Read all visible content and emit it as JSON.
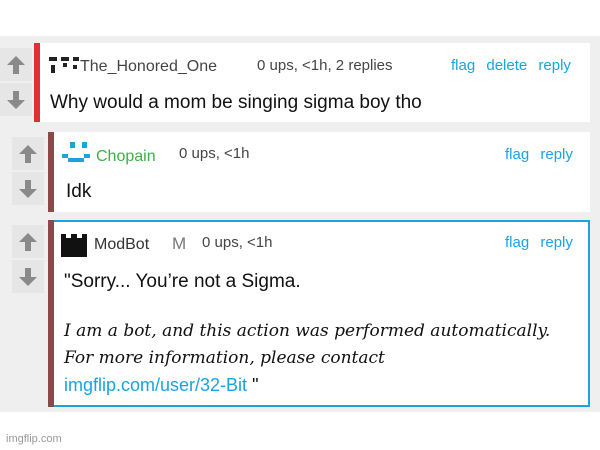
{
  "comments": [
    {
      "username": "The_Honored_One",
      "mod_badge": "",
      "meta": "0 ups, <1h, 2 replies",
      "actions": [
        "flag",
        "delete",
        "reply"
      ],
      "text": "Why would a mom be singing sigma boy tho",
      "accent_color": "#e03030",
      "username_color": "#444444"
    },
    {
      "username": "Chopain",
      "mod_badge": "",
      "meta": "0 ups, <1h",
      "actions": [
        "flag",
        "reply"
      ],
      "text": "Idk",
      "accent_color": "#8b4a4a",
      "username_color": "#3cb043"
    },
    {
      "username": "ModBot",
      "mod_badge": "M",
      "meta": "0 ups, <1h",
      "actions": [
        "flag",
        "reply"
      ],
      "text": "\"Sorry... You’re not a Sigma.",
      "bot_line1": "I am a bot, and this action was performed automatically.",
      "bot_line2": "For more information, please contact",
      "link_text": "imgflip.com/user/32-Bit",
      "closing_quote": " \"",
      "accent_color": "#8b4a4a",
      "border_color": "#1aa3e0",
      "username_color": "#333333"
    }
  ],
  "icons": {
    "upvote": "up-arrow-icon",
    "downvote": "down-arrow-icon"
  },
  "watermark": "imgflip.com"
}
